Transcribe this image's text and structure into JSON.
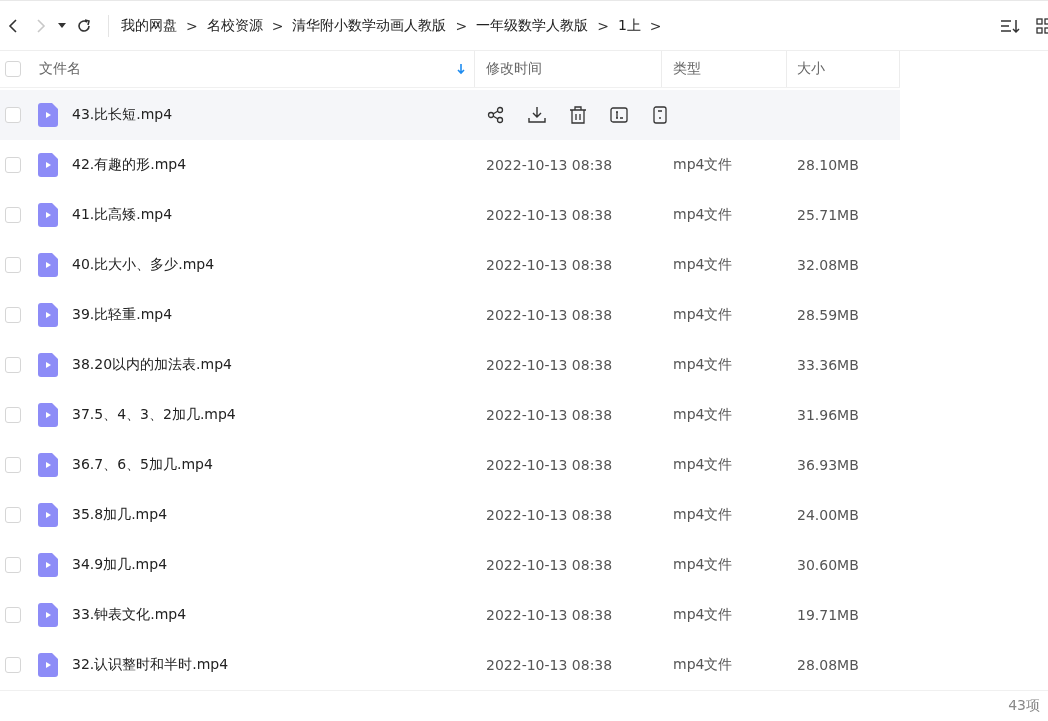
{
  "toolbar": {
    "back": {
      "disabled": false
    },
    "forward": {
      "disabled": true
    }
  },
  "breadcrumb": {
    "separator": ">",
    "items": [
      "我的网盘",
      "名校资源",
      "清华附小数学动画人教版",
      "一年级数学人教版",
      "1上"
    ]
  },
  "table": {
    "select_all": {
      "checked": false
    },
    "columns": [
      {
        "label": "文件名",
        "sorted": true
      },
      {
        "label": "修改时间",
        "sorted": false
      },
      {
        "label": "类型",
        "sorted": false
      },
      {
        "label": "大小",
        "sorted": false
      }
    ],
    "rows": [
      {
        "name": "43.比长短.mp4",
        "hovered": true,
        "checked": false
      },
      {
        "name": "42.有趣的形.mp4",
        "modified": "2022-10-13 08:38",
        "type": "mp4文件",
        "size": "28.10MB",
        "hovered": false,
        "checked": false
      },
      {
        "name": "41.比高矮.mp4",
        "modified": "2022-10-13 08:38",
        "type": "mp4文件",
        "size": "25.71MB",
        "hovered": false,
        "checked": false
      },
      {
        "name": "40.比大小、多少.mp4",
        "modified": "2022-10-13 08:38",
        "type": "mp4文件",
        "size": "32.08MB",
        "hovered": false,
        "checked": false
      },
      {
        "name": "39.比轻重.mp4",
        "modified": "2022-10-13 08:38",
        "type": "mp4文件",
        "size": "28.59MB",
        "hovered": false,
        "checked": false
      },
      {
        "name": "38.20以内的加法表.mp4",
        "modified": "2022-10-13 08:38",
        "type": "mp4文件",
        "size": "33.36MB",
        "hovered": false,
        "checked": false
      },
      {
        "name": "37.5、4、3、2加几.mp4",
        "modified": "2022-10-13 08:38",
        "type": "mp4文件",
        "size": "31.96MB",
        "hovered": false,
        "checked": false
      },
      {
        "name": "36.7、6、5加几.mp4",
        "modified": "2022-10-13 08:38",
        "type": "mp4文件",
        "size": "36.93MB",
        "hovered": false,
        "checked": false
      },
      {
        "name": "35.8加几.mp4",
        "modified": "2022-10-13 08:38",
        "type": "mp4文件",
        "size": "24.00MB",
        "hovered": false,
        "checked": false
      },
      {
        "name": "34.9加几.mp4",
        "modified": "2022-10-13 08:38",
        "type": "mp4文件",
        "size": "30.60MB",
        "hovered": false,
        "checked": false
      },
      {
        "name": "33.钟表文化.mp4",
        "modified": "2022-10-13 08:38",
        "type": "mp4文件",
        "size": "19.71MB",
        "hovered": false,
        "checked": false
      },
      {
        "name": "32.认识整时和半时.mp4",
        "modified": "2022-10-13 08:38",
        "type": "mp4文件",
        "size": "28.08MB",
        "hovered": false,
        "checked": false
      }
    ]
  },
  "status_bar": {
    "count": "43项"
  }
}
